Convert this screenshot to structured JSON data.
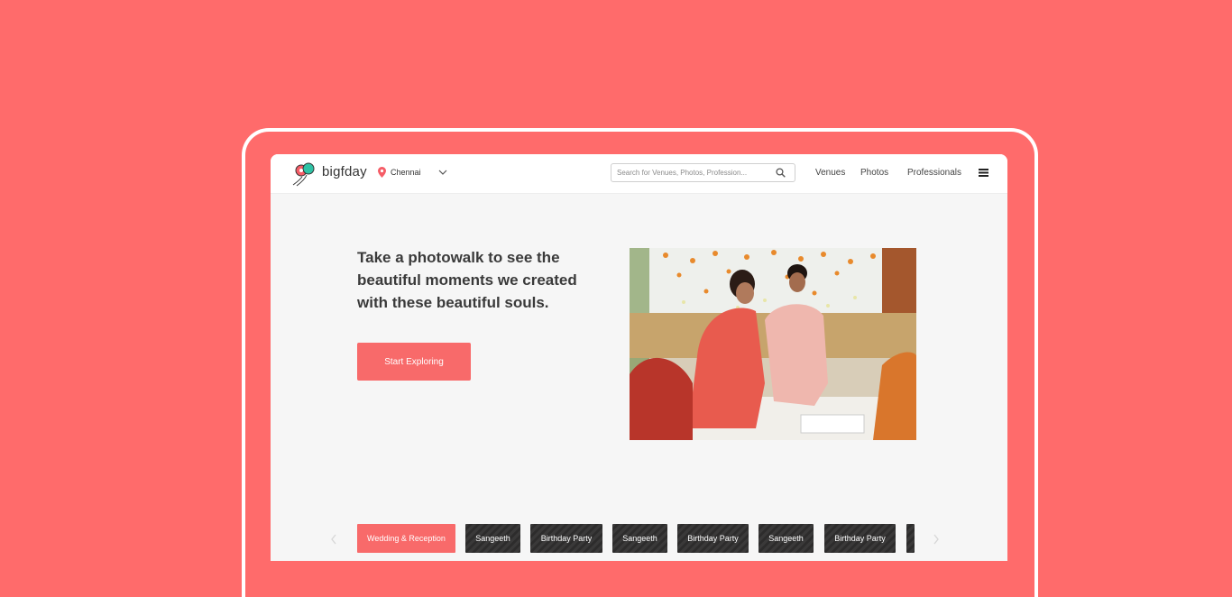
{
  "header": {
    "brand": "bigfday",
    "city": "Chennai",
    "search_placeholder": "Search for Venues, Photos, Profession...",
    "nav": [
      "Venues",
      "Photos",
      "Professionals"
    ]
  },
  "hero": {
    "title_lines": [
      "Take a photowalk to see the",
      "beautiful moments we created",
      "with these beautiful souls."
    ],
    "cta_label": "Start Exploring"
  },
  "categories": [
    {
      "label": "Wedding & Reception",
      "active": true
    },
    {
      "label": "Sangeeth",
      "active": false
    },
    {
      "label": "Birthday Party",
      "active": false
    },
    {
      "label": "Sangeeth",
      "active": false
    },
    {
      "label": "Birthday Party",
      "active": false
    },
    {
      "label": "Sangeeth",
      "active": false
    },
    {
      "label": "Birthday Party",
      "active": false
    },
    {
      "label": "",
      "active": false
    }
  ],
  "colors": {
    "background": "#ff6b6b",
    "accent": "#f86a6a",
    "screen": "#f6f6f6",
    "chip_dark": "#323131"
  },
  "icons": [
    "balloon-logo-icon",
    "location-pin-icon",
    "chevron-down-icon",
    "search-icon",
    "hamburger-menu-icon",
    "chevron-left-icon",
    "chevron-right-icon"
  ]
}
